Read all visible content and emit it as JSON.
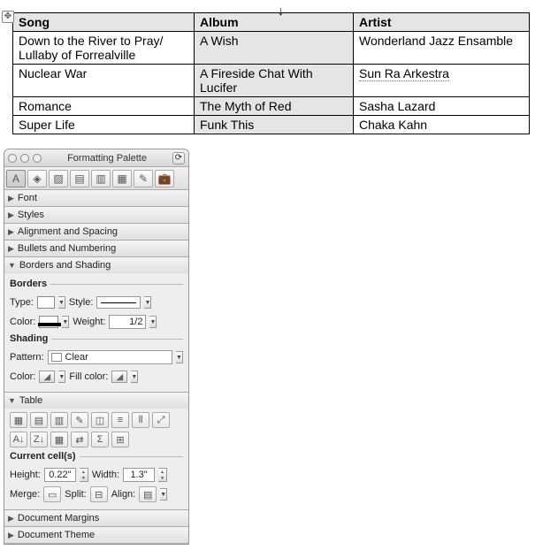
{
  "document": {
    "table": {
      "headers": [
        "Song",
        "Album",
        "Artist"
      ],
      "rows": [
        {
          "song": "Down to the River to Pray/ Lullaby of Forrealville",
          "album": "A Wish",
          "artist": "Wonderland Jazz Ensamble"
        },
        {
          "song": "Nuclear War",
          "album": "A Fireside Chat With Lucifer",
          "artist": "Sun Ra Arkestra"
        },
        {
          "song": "Romance",
          "album": "The Myth of Red",
          "artist": "Sasha Lazard"
        },
        {
          "song": "Super Life",
          "album": "Funk This",
          "artist": "Chaka Kahn"
        }
      ]
    }
  },
  "palette": {
    "title": "Formatting Palette",
    "sections": {
      "font": "Font",
      "styles": "Styles",
      "alignment": "Alignment and Spacing",
      "bullets": "Bullets and Numbering",
      "borders": {
        "title": "Borders and Shading",
        "borders_hdr": "Borders",
        "type_lbl": "Type:",
        "style_lbl": "Style:",
        "color_lbl": "Color:",
        "weight_lbl": "Weight:",
        "weight_val": "1/2",
        "shading_hdr": "Shading",
        "pattern_lbl": "Pattern:",
        "pattern_val": "Clear",
        "shade_color_lbl": "Color:",
        "fill_color_lbl": "Fill color:"
      },
      "table": {
        "title": "Table",
        "current_hdr": "Current cell(s)",
        "height_lbl": "Height:",
        "height_val": "0.22\"",
        "width_lbl": "Width:",
        "width_val": "1.3\"",
        "merge_lbl": "Merge:",
        "split_lbl": "Split:",
        "align_lbl": "Align:"
      },
      "margins": "Document Margins",
      "theme": "Document Theme"
    }
  }
}
